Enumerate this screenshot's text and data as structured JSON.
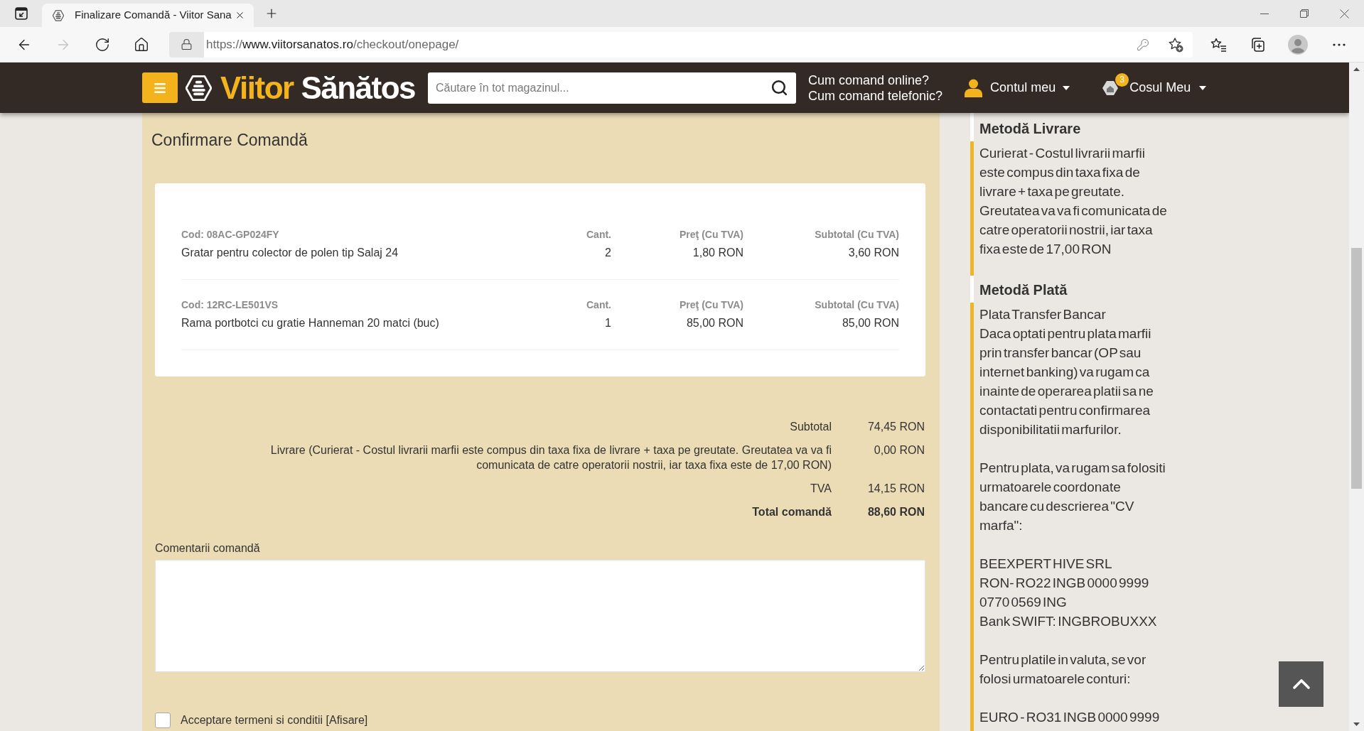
{
  "browser": {
    "tab": {
      "title": "Finalizare Comandă - Viitor Sana",
      "selected": true
    },
    "nav_buttons": [
      {
        "kind": "back",
        "disabled": false
      },
      {
        "kind": "forward",
        "disabled": true
      },
      {
        "kind": "reload",
        "disabled": false
      },
      {
        "kind": "home",
        "disabled": false
      }
    ],
    "url": {
      "scheme": "https://",
      "host": "www.viitorsanatos.ro",
      "path": "/checkout/onepage/"
    }
  },
  "header": {
    "logo": [
      "Viitor",
      "Sănătos"
    ],
    "search": {
      "placeholder": "Căutare în tot magazinul..."
    },
    "help_links": [
      "Cum comand online?",
      "Cum comand telefonic?"
    ],
    "account": "Contul meu",
    "cart": {
      "label": "Cosul Meu",
      "count": "3"
    }
  },
  "order": {
    "title": "Confirmare Comandă",
    "items": [
      {
        "code": "Cod: 08AC-GP024FY",
        "name": "Gratar pentru colector de polen tip Salaj 24",
        "qty_label": "Cant.",
        "qty": "2",
        "price_label": "Preţ (Cu TVA)",
        "price": "1,80 RON",
        "subtotal_label": "Subtotal (Cu TVA)",
        "subtotal": "3,60 RON"
      },
      {
        "code": "Cod: 12RC-LE501VS",
        "name": "Rama portbotci cu gratie Hanneman 20 matci (buc)",
        "qty_label": "Cant.",
        "qty": "1",
        "price_label": "Preţ (Cu TVA)",
        "price": "85,00 RON",
        "subtotal_label": "Subtotal (Cu TVA)",
        "subtotal": "85,00 RON"
      }
    ],
    "totals": [
      {
        "kind": "normal",
        "label": "Subtotal",
        "value": "74,45 RON"
      },
      {
        "kind": "normal",
        "label": "Livrare (Curierat - Costul livrarii marfii este compus din taxa fixa de livrare + taxa pe greutate. Greutatea va va fi comunicata de catre operatorii nostrii, iar taxa fixa este de 17,00 RON)",
        "value": "0,00 RON"
      },
      {
        "kind": "normal",
        "label": "TVA",
        "value": "14,15 RON"
      },
      {
        "kind": "grand",
        "label": "Total comandă",
        "value": "88,60 RON"
      }
    ],
    "comments": {
      "label": "Comentarii comandă"
    },
    "terms": {
      "label": "Acceptare termeni si conditii",
      "link": "[Afisare]",
      "checked": false
    }
  },
  "sidebar": {
    "sections": [
      {
        "heading": "Metodă Livrare",
        "paragraphs": [
          [
            "Curierat - Costul livrarii marfii este compus din taxa fixa de livrare + taxa pe greutate. Greutatea va va fi comunicata de catre operatorii nostrii, iar taxa fixa este de 17,00 RON"
          ]
        ]
      },
      {
        "heading": "Metodă Plată",
        "paragraphs": [
          [
            "Plata Transfer Bancar",
            "Daca optati pentru plata marfii prin transfer bancar (OP sau internet banking) va rugam ca inainte de operarea platii sa ne contactati pentru confirmarea disponibilitatii marfurilor."
          ],
          [
            "Pentru plata, va rugam sa folositi urmatoarele coordonate bancare cu descrierea \"CV marfa\":"
          ],
          [
            "BEEXPERT HIVE SRL",
            "RON- RO22 INGB 0000 9999 0770 0569 ING",
            "Bank SWIFT: INGBROBUXXX"
          ],
          [
            "Pentru platile in valuta, se vor folosi urmatoarele conturi:"
          ],
          [
            "EURO - RO31 INGB 0000 9999"
          ]
        ]
      }
    ]
  }
}
